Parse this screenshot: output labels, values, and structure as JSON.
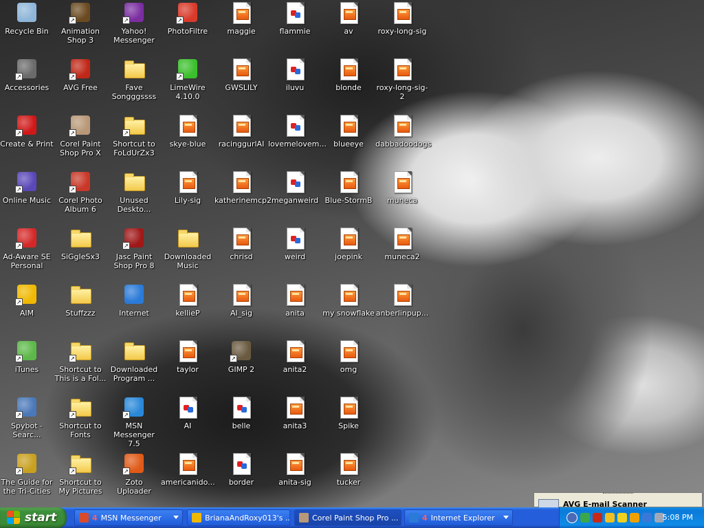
{
  "desktop": {
    "icons": [
      {
        "label": "Recycle Bin",
        "icon": "recycle-bin-icon",
        "kind": "app",
        "color": "#8fb6d8",
        "shortcut": false
      },
      {
        "label": "Animation Shop 3",
        "icon": "animation-shop-icon",
        "kind": "app",
        "color": "#6a4a20",
        "shortcut": true
      },
      {
        "label": "Yahoo! Messenger",
        "icon": "yahoo-messenger-icon",
        "kind": "app",
        "color": "#7b2ea0",
        "shortcut": true
      },
      {
        "label": "PhotoFiltre",
        "icon": "photofiltre-icon",
        "kind": "app",
        "color": "#d83a2a",
        "shortcut": true
      },
      {
        "label": "maggie",
        "icon": "image-file-icon",
        "kind": "file"
      },
      {
        "label": "flammie",
        "icon": "bitmap-file-icon",
        "kind": "bmp"
      },
      {
        "label": "av",
        "icon": "image-file-icon",
        "kind": "file"
      },
      {
        "label": "roxy-long-sig",
        "icon": "image-file-icon",
        "kind": "file"
      },
      {
        "label": "Accessories",
        "icon": "accessories-icon",
        "kind": "app",
        "color": "#6a6a6a",
        "shortcut": true
      },
      {
        "label": "AVG Free",
        "icon": "avg-free-icon",
        "kind": "app",
        "color": "#c02818",
        "shortcut": true
      },
      {
        "label": "Fave Songggssss",
        "icon": "folder-icon",
        "kind": "folder"
      },
      {
        "label": "LimeWire 4.10.0",
        "icon": "limewire-icon",
        "kind": "app",
        "color": "#3bbf2c",
        "shortcut": true
      },
      {
        "label": "GWSLILY",
        "icon": "image-file-icon",
        "kind": "file"
      },
      {
        "label": "iluvu",
        "icon": "bitmap-file-icon",
        "kind": "bmp"
      },
      {
        "label": "blonde",
        "icon": "image-file-icon",
        "kind": "file"
      },
      {
        "label": "roxy-long-sig-2",
        "icon": "image-file-icon",
        "kind": "file"
      },
      {
        "label": "Create & Print",
        "icon": "create-print-icon",
        "kind": "app",
        "color": "#d01818",
        "shortcut": true
      },
      {
        "label": "Corel Paint Shop Pro X",
        "icon": "corel-paint-shop-icon",
        "kind": "app",
        "color": "#b89878",
        "shortcut": true
      },
      {
        "label": "Shortcut to FoLdUrZx3",
        "icon": "folder-icon",
        "kind": "folder",
        "shortcut": true
      },
      {
        "label": "skye-blue",
        "icon": "image-file-icon",
        "kind": "file"
      },
      {
        "label": "racinggurlAI",
        "icon": "image-file-icon",
        "kind": "file"
      },
      {
        "label": "lovemelovem...",
        "icon": "bitmap-file-icon",
        "kind": "bmp"
      },
      {
        "label": "blueeye",
        "icon": "image-file-icon",
        "kind": "file"
      },
      {
        "label": "dabbadoodogs",
        "icon": "image-file-icon",
        "kind": "file"
      },
      {
        "label": "Online Music",
        "icon": "online-music-icon",
        "kind": "app",
        "color": "#5a48b8",
        "shortcut": true
      },
      {
        "label": "Corel Photo Album 6",
        "icon": "corel-photo-album-icon",
        "kind": "app",
        "color": "#c83828",
        "shortcut": true
      },
      {
        "label": "Unused Deskto...",
        "icon": "folder-icon",
        "kind": "folder"
      },
      {
        "label": "Lily-sig",
        "icon": "image-file-icon",
        "kind": "file"
      },
      {
        "label": "katherinemcp2",
        "icon": "image-file-icon",
        "kind": "file"
      },
      {
        "label": "meganweird",
        "icon": "bitmap-file-icon",
        "kind": "bmp"
      },
      {
        "label": "Blue-StormB",
        "icon": "image-file-icon",
        "kind": "file"
      },
      {
        "label": "muneca",
        "icon": "image-file-icon",
        "kind": "file"
      },
      {
        "label": "Ad-Aware SE Personal",
        "icon": "ad-aware-icon",
        "kind": "app",
        "color": "#d42828",
        "shortcut": true
      },
      {
        "label": "SiGgIeSx3",
        "icon": "folder-icon",
        "kind": "folder"
      },
      {
        "label": "Jasc Paint Shop Pro 8",
        "icon": "jasc-paint-shop-icon",
        "kind": "app",
        "color": "#a01818",
        "shortcut": true
      },
      {
        "label": "Downloaded Music",
        "icon": "folder-icon",
        "kind": "folder"
      },
      {
        "label": "chrisd",
        "icon": "image-file-icon",
        "kind": "file"
      },
      {
        "label": "weird",
        "icon": "bitmap-file-icon",
        "kind": "bmp"
      },
      {
        "label": "joepink",
        "icon": "image-file-icon",
        "kind": "file"
      },
      {
        "label": "muneca2",
        "icon": "image-file-icon",
        "kind": "file"
      },
      {
        "label": "AIM",
        "icon": "aim-icon",
        "kind": "app",
        "color": "#f0b800",
        "shortcut": true
      },
      {
        "label": "Stuffzzz",
        "icon": "folder-icon",
        "kind": "folder"
      },
      {
        "label": "Internet",
        "icon": "internet-explorer-icon",
        "kind": "app",
        "color": "#2a7ad8",
        "shortcut": false
      },
      {
        "label": "kellieP",
        "icon": "image-file-icon",
        "kind": "file"
      },
      {
        "label": "AI_sig",
        "icon": "image-file-icon",
        "kind": "file"
      },
      {
        "label": "anita",
        "icon": "image-file-icon",
        "kind": "file"
      },
      {
        "label": "my snowflake",
        "icon": "image-file-icon",
        "kind": "file"
      },
      {
        "label": "anberlinpup...",
        "icon": "image-file-icon",
        "kind": "file"
      },
      {
        "label": "iTunes",
        "icon": "itunes-icon",
        "kind": "app",
        "color": "#5cb848",
        "shortcut": true
      },
      {
        "label": "Shortcut to This is a Fol...",
        "icon": "folder-icon",
        "kind": "folder",
        "shortcut": true
      },
      {
        "label": "Downloaded Program ...",
        "icon": "folder-icon",
        "kind": "folder"
      },
      {
        "label": "taylor",
        "icon": "image-file-icon",
        "kind": "file"
      },
      {
        "label": "GIMP 2",
        "icon": "gimp-icon",
        "kind": "app",
        "color": "#6a5a40",
        "shortcut": true
      },
      {
        "label": "anita2",
        "icon": "image-file-icon",
        "kind": "file"
      },
      {
        "label": "omg",
        "icon": "image-file-icon",
        "kind": "file"
      },
      {
        "label": "Spybot - Searc...",
        "icon": "spybot-icon",
        "kind": "app",
        "color": "#4a78b8",
        "shortcut": true
      },
      {
        "label": "Shortcut to Fonts",
        "icon": "fonts-folder-icon",
        "kind": "folder",
        "shortcut": true
      },
      {
        "label": "MSN Messenger 7.5",
        "icon": "msn-messenger-icon",
        "kind": "app",
        "color": "#2a88d8",
        "shortcut": true
      },
      {
        "label": "AI",
        "icon": "bitmap-file-icon",
        "kind": "bmp"
      },
      {
        "label": "belle",
        "icon": "bitmap-file-icon",
        "kind": "bmp"
      },
      {
        "label": "anita3",
        "icon": "image-file-icon",
        "kind": "file"
      },
      {
        "label": "Spike",
        "icon": "image-file-icon",
        "kind": "file"
      },
      {
        "label": "The Guide for the Tri-Cities",
        "icon": "tri-cities-guide-icon",
        "kind": "app",
        "color": "#c8a020",
        "shortcut": true
      },
      {
        "label": "Shortcut to My Pictures",
        "icon": "my-pictures-folder-icon",
        "kind": "folder",
        "shortcut": true
      },
      {
        "label": "Zoto Uploader",
        "icon": "zoto-uploader-icon",
        "kind": "app",
        "color": "#e05a18",
        "shortcut": true
      },
      {
        "label": "americanido...",
        "icon": "image-file-icon",
        "kind": "file"
      },
      {
        "label": "border",
        "icon": "bitmap-file-icon",
        "kind": "bmp"
      },
      {
        "label": "anita-sig",
        "icon": "image-file-icon",
        "kind": "file"
      },
      {
        "label": "tucker",
        "icon": "image-file-icon",
        "kind": "file"
      }
    ]
  },
  "notification": {
    "title": "AVG E-mail Scanner"
  },
  "taskbar": {
    "start_label": "start",
    "tasks": [
      {
        "count": "4",
        "label": "MSN Messenger",
        "icon": "msn-messenger-icon",
        "color": "#d84a2a",
        "group": true
      },
      {
        "count": "",
        "label": "BrianaAndRoxy013's ...",
        "icon": "aim-icon",
        "color": "#f0b800",
        "group": false
      },
      {
        "count": "",
        "label": "Corel Paint Shop Pro ...",
        "icon": "corel-paint-shop-icon",
        "color": "#b89878",
        "group": false
      },
      {
        "count": "4",
        "label": "Internet Explorer",
        "icon": "internet-explorer-icon",
        "color": "#2a7ad8",
        "group": true
      }
    ],
    "tray_icons": [
      "back-arrow-icon",
      "network-icon",
      "avg-icon",
      "notification-bell-icon",
      "yahoo-smiley-icon",
      "aim-tray-icon",
      "msn-buddy-icon",
      "tools-icon"
    ],
    "clock": "5:08 PM"
  }
}
